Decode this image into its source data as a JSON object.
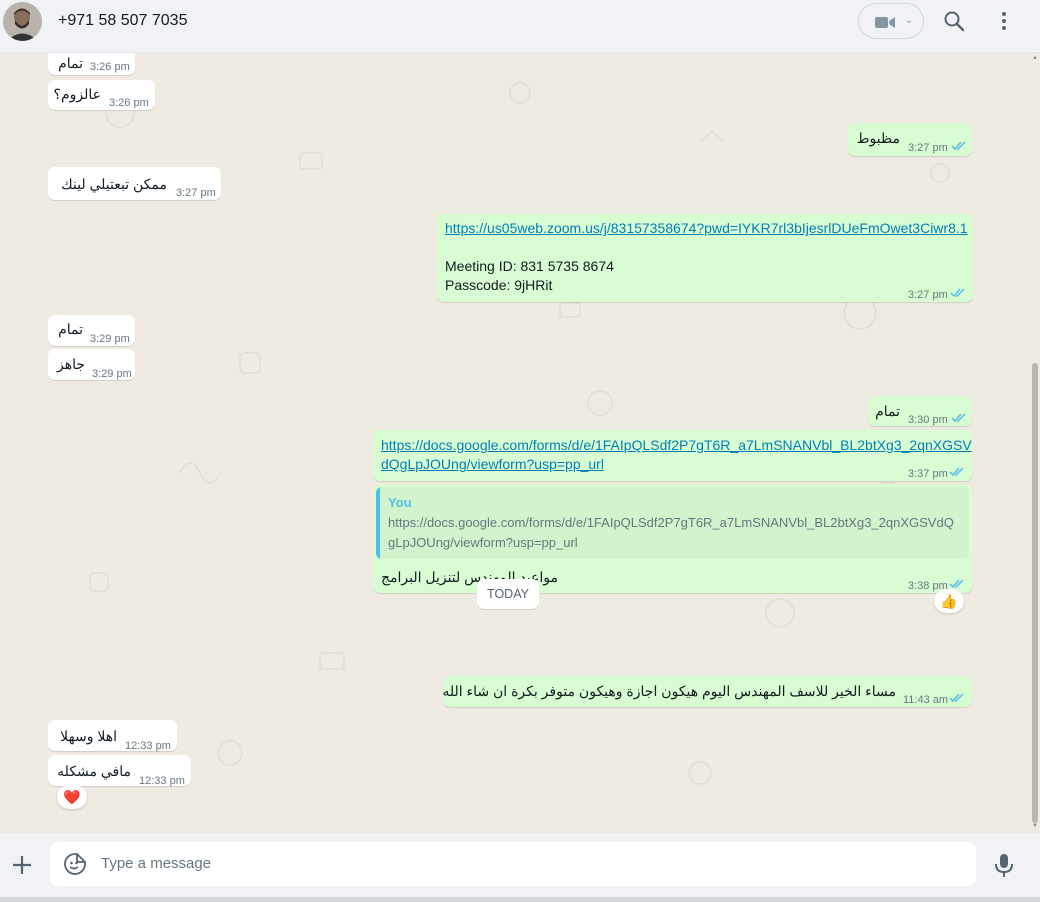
{
  "header": {
    "contact_name": "+971 58 507 7035",
    "icons": [
      "avatar",
      "video-call-icon",
      "chevron-down-icon",
      "search-icon",
      "menu-icon"
    ]
  },
  "messages": [
    {
      "dir": "in",
      "text": "تمام",
      "time": "3:26 pm"
    },
    {
      "dir": "in",
      "text": "عالزوم؟",
      "time": "3:26 pm"
    },
    {
      "dir": "out",
      "text": "مظبوط",
      "time": "3:27 pm",
      "status": "read"
    },
    {
      "dir": "in",
      "text": "ممكن تبعتيلي لينك",
      "time": "3:27 pm"
    },
    {
      "dir": "out",
      "link": "https://us05web.zoom.us/j/83157358674?pwd=IYKR7rl3bIjesrlDUeFmOwet3Ciwr8.1",
      "line1": "Meeting ID: 831 5735 8674",
      "line2": "Passcode: 9jHRit",
      "time": "3:27 pm",
      "status": "read"
    },
    {
      "dir": "in",
      "text": "تمام",
      "time": "3:29 pm"
    },
    {
      "dir": "in",
      "text": "جاهز",
      "time": "3:29 pm"
    },
    {
      "dir": "out",
      "text": "تمام",
      "time": "3:30 pm",
      "status": "read"
    },
    {
      "dir": "out",
      "link_line1": "https://docs.google.com/forms/d/e/1FAIpQLSdf2P7gT6R_a7LmSNANVbl_BL2btXg3_2qnXGSV",
      "link_line2": "dQgLpJOUng/viewform?usp=pp_url",
      "time": "3:37 pm",
      "status": "read"
    },
    {
      "dir": "out",
      "quote_author": "You",
      "quote_text": "https://docs.google.com/forms/d/e/1FAIpQLSdf2P7gT6R_a7LmSNANVbl_BL2btXg3_2qnXGSVdQgLpJOUng/viewform?usp=pp_url",
      "text": "مواعيد المهندس لتنزيل البرامج",
      "time": "3:38 pm",
      "status": "read",
      "reaction": "👍"
    },
    {
      "dir": "out",
      "text": "مساء الخير للاسف المهندس اليوم هيكون اجازة وهيكون متوفر بكرة ان شاء الله",
      "time": "11:43 am",
      "status": "read"
    },
    {
      "dir": "in",
      "text": "اهلا وسهلا",
      "time": "12:33 pm"
    },
    {
      "dir": "in",
      "text": "مافي مشكله",
      "time": "12:33 pm",
      "reaction": "❤️"
    }
  ],
  "date_divider": "TODAY",
  "composer": {
    "placeholder": "Type a message",
    "icons": [
      "plus-icon",
      "sticker-icon",
      "mic-icon"
    ]
  },
  "colors": {
    "incoming": "#ffffff",
    "outgoing": "#d9fdd3",
    "read_ticks": "#53bdeb",
    "link": "#027eb5",
    "wallpaper": "#efeae2"
  }
}
